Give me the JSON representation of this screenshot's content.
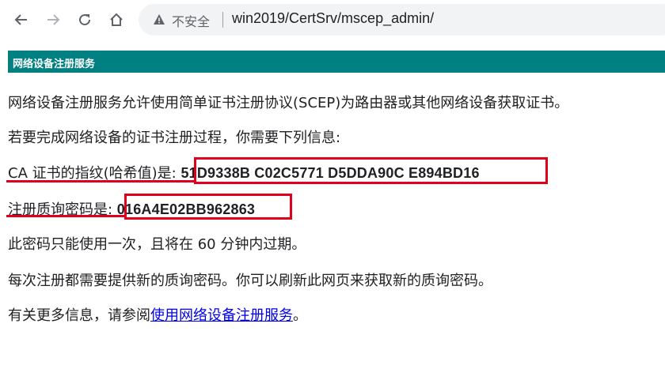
{
  "browser": {
    "security_label": "不安全",
    "url": "win2019/CertSrv/mscep_admin/"
  },
  "page": {
    "header": "网络设备注册服务",
    "intro": "网络设备注册服务允许使用简单证书注册协议(SCEP)为路由器或其他网络设备获取证书。",
    "need_info": "若要完成网络设备的证书注册过程，你需要下列信息:",
    "ca_label": "CA 证书的指纹(哈希值)是: ",
    "ca_thumbprint": "51D9338B C02C5771 D5DDA90C E894BD16",
    "challenge_label": "注册质询密码是: ",
    "challenge_password": "016A4E02BB962863",
    "once_note": "此密码只能使用一次，且将在 60 分钟内过期。",
    "refresh_note": "每次注册都需要提供新的质询密码。你可以刷新此网页来获取新的质询密码。",
    "more_info_prefix": "有关更多信息，请参阅",
    "more_info_link": "使用网络设备注册服务",
    "more_info_suffix": "。"
  },
  "annotations": {
    "highlight_color": "#e0001b"
  }
}
